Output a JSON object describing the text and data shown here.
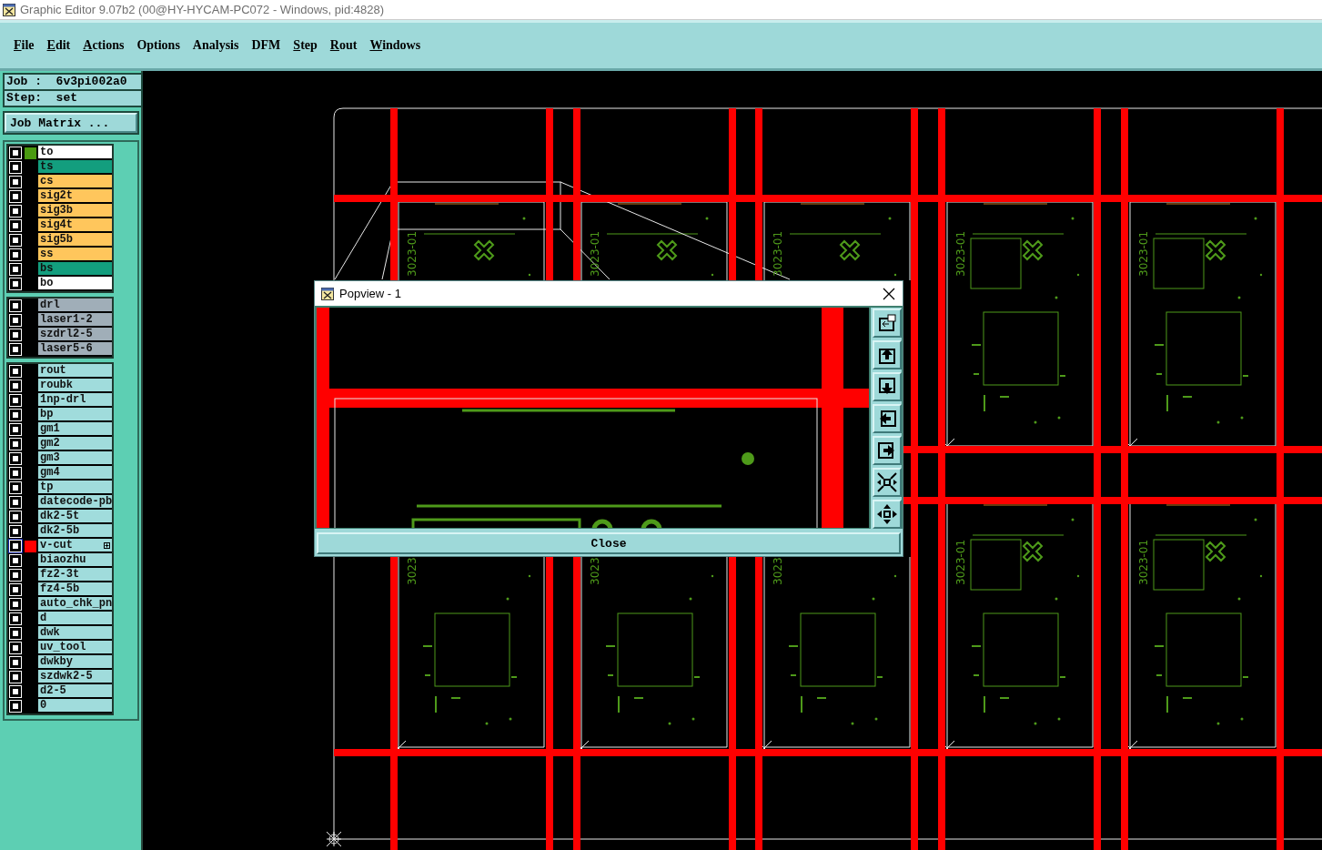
{
  "window": {
    "title": "Graphic Editor 9.07b2 (00@HY-HYCAM-PC072 - Windows, pid:4828)"
  },
  "menu": [
    {
      "label": "File",
      "underlined": true
    },
    {
      "label": "Edit",
      "underlined": true
    },
    {
      "label": "Actions",
      "underlined": true
    },
    {
      "label": "Options",
      "underlined": false
    },
    {
      "label": "Analysis",
      "underlined": false
    },
    {
      "label": "DFM",
      "underlined": false
    },
    {
      "label": "Step",
      "underlined": true
    },
    {
      "label": "Rout",
      "underlined": true
    },
    {
      "label": "Windows",
      "underlined": true
    }
  ],
  "job": {
    "job_label": "Job :  6v3pi002a0",
    "step_label": "Step:  set",
    "matrix_button": "Job Matrix ..."
  },
  "layer_groups": [
    {
      "layers": [
        {
          "name": "to",
          "kind": "silkscreen",
          "color": "#4a9a10",
          "selected": false,
          "features_shown": false
        },
        {
          "name": "ts",
          "kind": "soldermask",
          "selected": false,
          "features_shown": false
        },
        {
          "name": "cs",
          "kind": "signal",
          "selected": false,
          "features_shown": false
        },
        {
          "name": "sig2t",
          "kind": "signal",
          "selected": false,
          "features_shown": false
        },
        {
          "name": "sig3b",
          "kind": "signal",
          "selected": false,
          "features_shown": false
        },
        {
          "name": "sig4t",
          "kind": "signal",
          "selected": false,
          "features_shown": false
        },
        {
          "name": "sig5b",
          "kind": "signal",
          "selected": false,
          "features_shown": false
        },
        {
          "name": "ss",
          "kind": "signal",
          "selected": false,
          "features_shown": false
        },
        {
          "name": "bs",
          "kind": "soldermask",
          "selected": false,
          "features_shown": false
        },
        {
          "name": "bo",
          "kind": "silkscreen",
          "selected": false,
          "features_shown": false
        }
      ]
    },
    {
      "layers": [
        {
          "name": "drl",
          "kind": "drill",
          "selected": false,
          "features_shown": false
        },
        {
          "name": "laser1-2",
          "kind": "drill",
          "selected": false,
          "features_shown": false
        },
        {
          "name": "szdrl2-5",
          "kind": "drill",
          "selected": false,
          "features_shown": false
        },
        {
          "name": "laser5-6",
          "kind": "drill",
          "selected": false,
          "features_shown": false
        }
      ]
    },
    {
      "layers": [
        {
          "name": "rout",
          "kind": "document",
          "selected": false,
          "features_shown": false
        },
        {
          "name": "roubk",
          "kind": "document",
          "selected": false,
          "features_shown": false
        },
        {
          "name": "1np-drl",
          "kind": "document",
          "selected": false,
          "features_shown": false
        },
        {
          "name": "bp",
          "kind": "document",
          "selected": false,
          "features_shown": false
        },
        {
          "name": "gm1",
          "kind": "document",
          "selected": false,
          "features_shown": false
        },
        {
          "name": "gm2",
          "kind": "document",
          "selected": false,
          "features_shown": false
        },
        {
          "name": "gm3",
          "kind": "document",
          "selected": false,
          "features_shown": false
        },
        {
          "name": "gm4",
          "kind": "document",
          "selected": false,
          "features_shown": false
        },
        {
          "name": "tp",
          "kind": "document",
          "selected": false,
          "features_shown": false
        },
        {
          "name": "datecode-pb",
          "kind": "document",
          "selected": false,
          "features_shown": false
        },
        {
          "name": "dk2-5t",
          "kind": "document",
          "selected": false,
          "features_shown": false
        },
        {
          "name": "dk2-5b",
          "kind": "document",
          "selected": false,
          "features_shown": false
        },
        {
          "name": "v-cut",
          "kind": "document",
          "color": "#ff0000",
          "selected": true,
          "features_shown": true
        },
        {
          "name": "biaozhu",
          "kind": "document",
          "selected": false,
          "features_shown": false
        },
        {
          "name": "fz2-3t",
          "kind": "document",
          "selected": false,
          "features_shown": false
        },
        {
          "name": "fz4-5b",
          "kind": "document",
          "selected": false,
          "features_shown": false
        },
        {
          "name": "auto_chk_pn",
          "kind": "document",
          "selected": false,
          "features_shown": false
        },
        {
          "name": "d",
          "kind": "document",
          "selected": false,
          "features_shown": false
        },
        {
          "name": "dwk",
          "kind": "document",
          "selected": false,
          "features_shown": false
        },
        {
          "name": "uv_tool",
          "kind": "document",
          "selected": false,
          "features_shown": false
        },
        {
          "name": "dwkby",
          "kind": "document",
          "selected": false,
          "features_shown": false
        },
        {
          "name": "szdwk2-5",
          "kind": "document",
          "selected": false,
          "features_shown": false
        },
        {
          "name": "d2-5",
          "kind": "document",
          "selected": false,
          "features_shown": false
        },
        {
          "name": "0",
          "kind": "document",
          "selected": false,
          "features_shown": false
        }
      ]
    }
  ],
  "canvas": {
    "panels": [
      {
        "label": "3023-01"
      },
      {
        "label": "3023-01"
      },
      {
        "label": "3023-01"
      },
      {
        "label": "3023-01"
      },
      {
        "label": "3023-01"
      },
      {
        "label": "3023"
      },
      {
        "label": "3023"
      },
      {
        "label": "3023"
      },
      {
        "label": "3023-01"
      },
      {
        "label": "3023-01"
      }
    ]
  },
  "popview": {
    "title": "Popview - 1",
    "close_button": "Close"
  }
}
